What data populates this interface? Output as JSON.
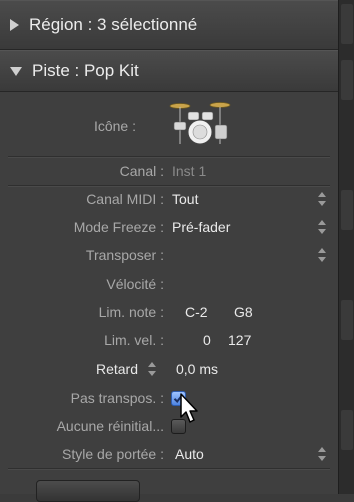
{
  "region_header": {
    "label": "Région : 3 sélectionné"
  },
  "track_header": {
    "label": "Piste : Pop Kit"
  },
  "icon_row": {
    "label": "Icône :",
    "icon_name": "drum-kit-icon"
  },
  "fields": {
    "channel": {
      "label": "Canal :",
      "value": "Inst 1"
    },
    "midi_channel": {
      "label": "Canal MIDI :",
      "value": "Tout"
    },
    "freeze_mode": {
      "label": "Mode Freeze :",
      "value": "Pré-fader"
    },
    "transpose": {
      "label": "Transposer :",
      "value": ""
    },
    "velocity": {
      "label": "Vélocité :",
      "value": ""
    },
    "key_limit": {
      "label": "Lim. note :",
      "low": "C-2",
      "high": "G8"
    },
    "vel_limit": {
      "label": "Lim. vel. :",
      "low": "0",
      "high": "127"
    },
    "delay": {
      "label": "Retard",
      "value": "0,0 ms"
    },
    "no_transpose": {
      "label": "Pas transpos. :",
      "checked": true
    },
    "no_reset": {
      "label": "Aucune réinitial...",
      "checked": false
    },
    "staff_style": {
      "label": "Style de portée :",
      "value": "Auto"
    }
  },
  "colors": {
    "panel": "#3f3f3f",
    "checkbox_on": "#4e84e0",
    "label": "#a8a8a8"
  }
}
